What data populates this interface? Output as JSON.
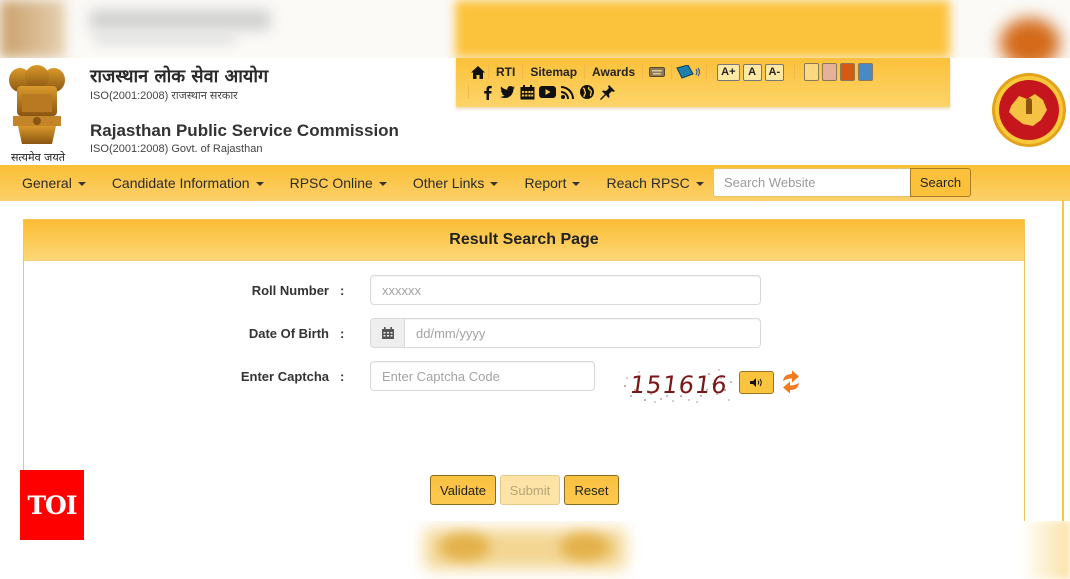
{
  "header": {
    "hindi_title": "राजस्थान लोक सेवा आयोग",
    "hindi_subtitle": "ISO(2001:2008) राजस्थान सरकार",
    "english_title": "Rajasthan Public Service Commission",
    "english_subtitle": "ISO(2001:2008) Govt. of Rajasthan",
    "emblem_motto": "सत्यमेव जयते"
  },
  "utility_bar": {
    "links": [
      "RTI",
      "Sitemap",
      "Awards"
    ],
    "icons_row1": [
      "home-icon",
      "keyboard-icon",
      "screen-reader-icon"
    ],
    "icons_row2": [
      "facebook-icon",
      "twitter-icon",
      "calendar-icon",
      "youtube-icon",
      "rss-icon",
      "globe-icon",
      "pin-icon"
    ],
    "font_sizes": [
      "A+",
      "A",
      "A-"
    ],
    "theme_swatches": [
      "#fcd880",
      "#e7b199",
      "#d35a13",
      "#4a8ac4"
    ]
  },
  "nav": {
    "items": [
      "General",
      "Candidate Information",
      "RPSC Online",
      "Other Links",
      "Report",
      "Reach RPSC"
    ],
    "search_placeholder": "Search Website",
    "search_button": "Search"
  },
  "panel": {
    "title": "Result Search Page",
    "fields": [
      {
        "label": "Roll Number",
        "colon": ":",
        "placeholder": "xxxxxx",
        "value": ""
      },
      {
        "label": "Date Of Birth",
        "colon": ":",
        "placeholder": "dd/mm/yyyy",
        "value": ""
      },
      {
        "label": "Enter Captcha",
        "colon": ":",
        "placeholder": "Enter Captcha Code",
        "value": ""
      }
    ],
    "captcha_code": "151616",
    "buttons": {
      "validate": "Validate",
      "submit": "Submit",
      "reset": "Reset"
    }
  },
  "watermark": {
    "text": "TOI",
    "color": "#ff0000"
  },
  "colors": {
    "accent": "#fbc13a",
    "accent_light": "#fdd777",
    "refresh": "#f07a22"
  }
}
